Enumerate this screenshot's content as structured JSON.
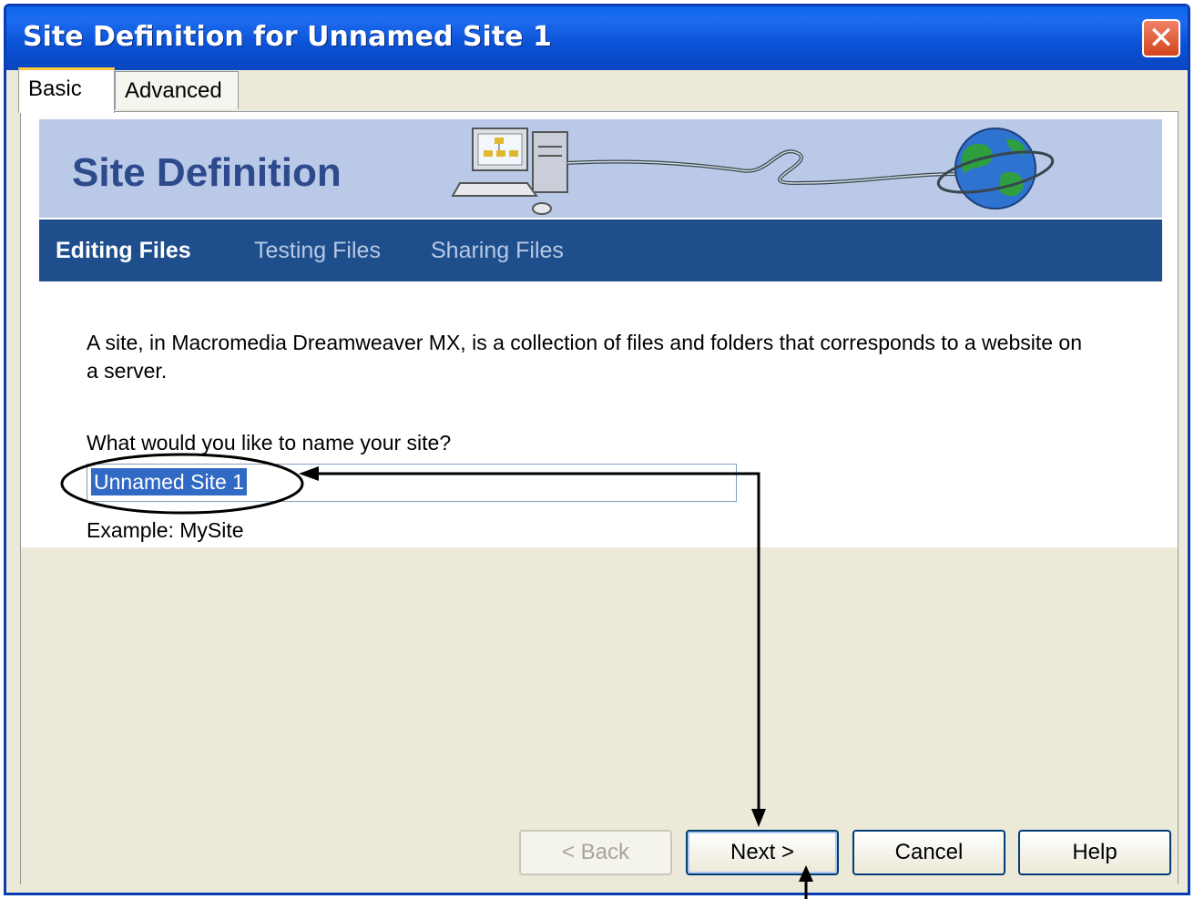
{
  "window": {
    "title": "Site Definition for Unnamed Site 1",
    "close_glyph": "✕"
  },
  "tabs": [
    {
      "label": "Basic"
    },
    {
      "label": "Advanced"
    }
  ],
  "banner": {
    "title": "Site Definition"
  },
  "nav": [
    {
      "label": "Editing Files"
    },
    {
      "label": "Testing Files"
    },
    {
      "label": "Sharing Files"
    }
  ],
  "content": {
    "description": "A site, in Macromedia Dreamweaver MX, is a collection of files and folders that corresponds to a website on a server.",
    "question": "What would you like to name your site?",
    "site_name_value": "Unnamed Site 1",
    "example": "Example: MySite"
  },
  "buttons": {
    "back": "< Back",
    "next": "Next >",
    "cancel": "Cancel",
    "help": "Help"
  },
  "colors": {
    "titlebar": "#0a52d6",
    "nav_bg": "#1e4f8c",
    "banner_bg": "#b9c9e7",
    "selection": "#316ac5"
  }
}
